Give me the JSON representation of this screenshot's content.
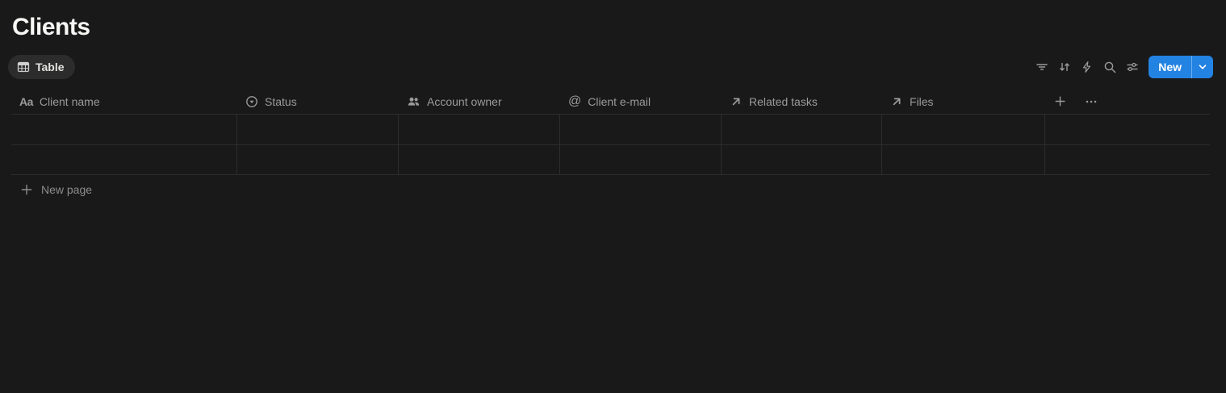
{
  "page": {
    "title": "Clients"
  },
  "view_bar": {
    "active_view": {
      "label": "Table",
      "icon": "table-grid-icon"
    }
  },
  "toolbar": {
    "icons": [
      "filter-icon",
      "sort-icon",
      "lightning-icon",
      "search-icon",
      "sliders-icon"
    ],
    "new_button": {
      "label": "New",
      "color": "#2383e2"
    }
  },
  "table": {
    "columns": [
      {
        "label": "Client name",
        "icon": "title-text-icon",
        "icon_text": "Aa"
      },
      {
        "label": "Status",
        "icon": "status-icon"
      },
      {
        "label": "Account owner",
        "icon": "people-icon"
      },
      {
        "label": "Client e-mail",
        "icon": "at-sign-icon",
        "icon_text": "@"
      },
      {
        "label": "Related tasks",
        "icon": "relation-arrow-icon"
      },
      {
        "label": "Files",
        "icon": "relation-arrow-icon"
      }
    ],
    "rows": [
      {
        "cells": [
          "",
          "",
          "",
          "",
          "",
          ""
        ]
      },
      {
        "cells": [
          "",
          "",
          "",
          "",
          "",
          ""
        ]
      }
    ],
    "new_page_label": "New page"
  },
  "colors": {
    "background": "#191919",
    "border": "#2d2d2d",
    "accent": "#2383e2",
    "muted_text": "#9b9b9b",
    "title_text": "#f7f7f5"
  }
}
